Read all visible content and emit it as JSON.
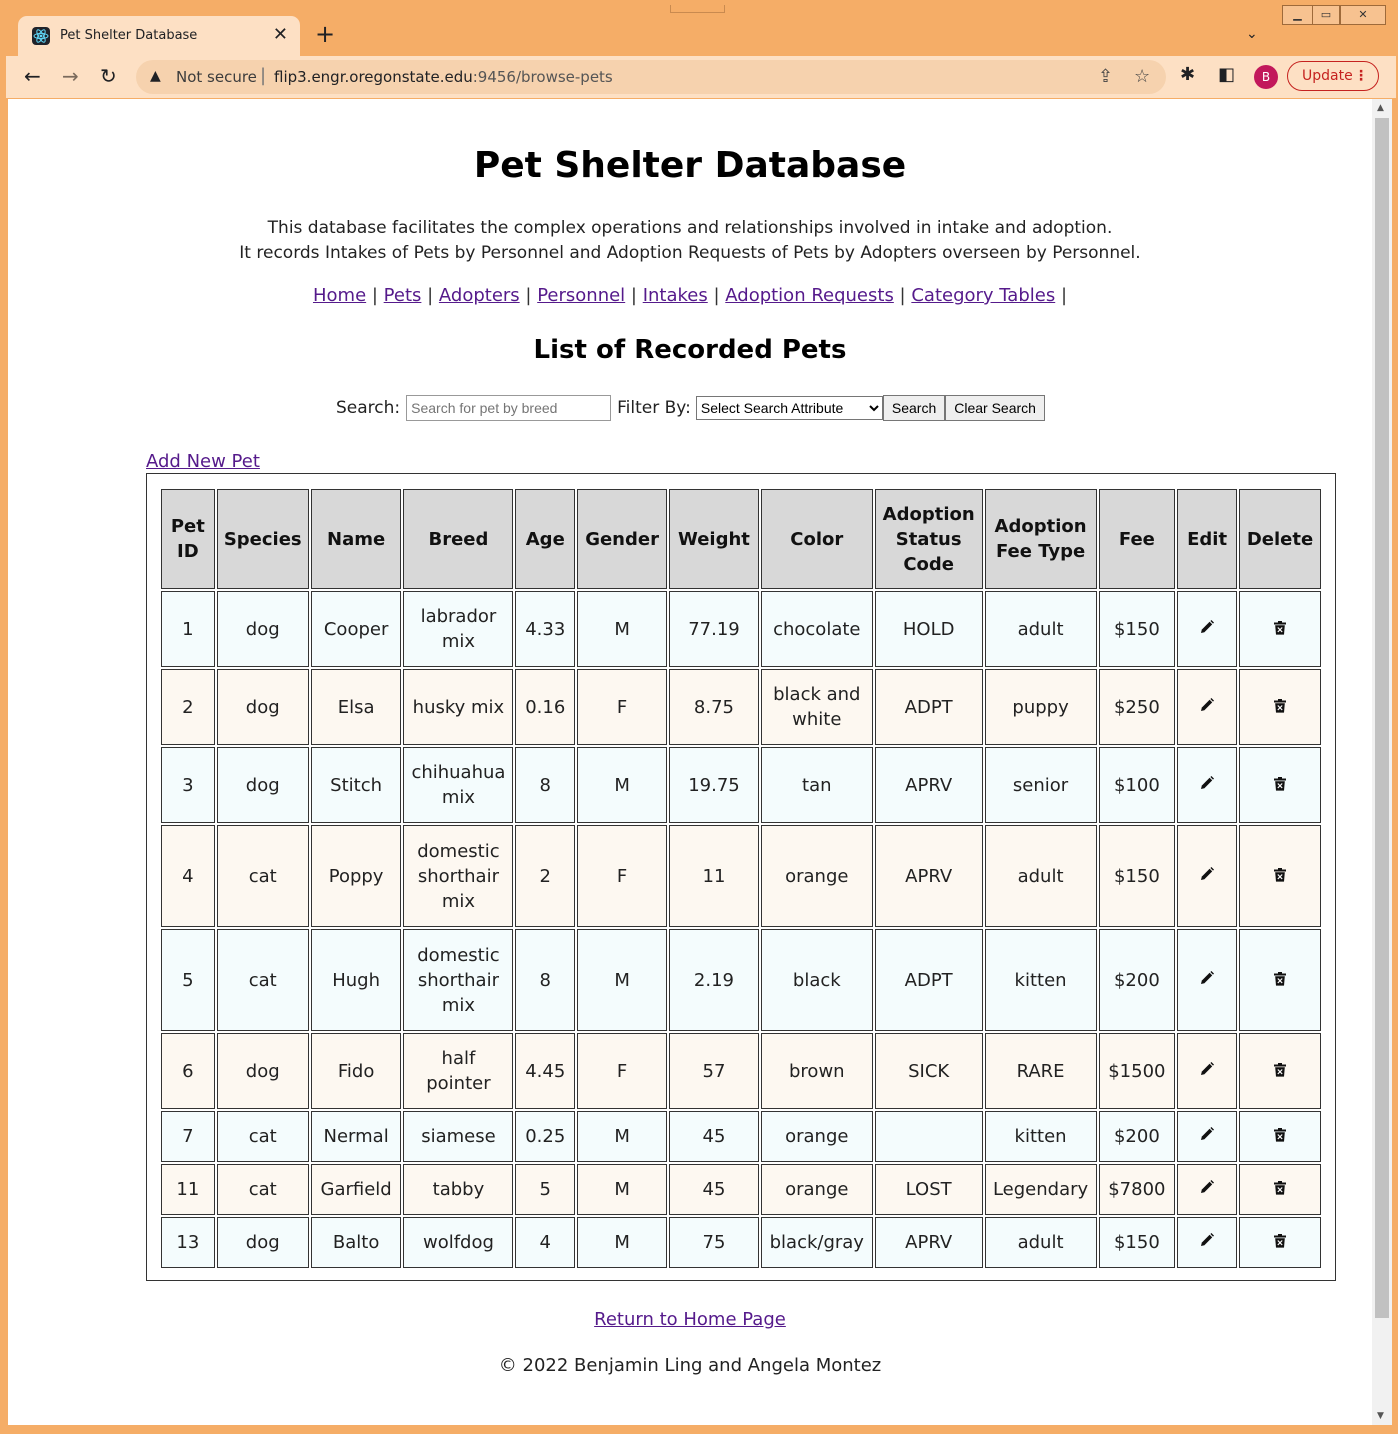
{
  "browser": {
    "tab_title": "Pet Shelter Database",
    "not_secure": "Not secure",
    "url_host": "flip3.engr.oregonstate.edu",
    "url_path": ":9456/browse-pets",
    "update_label": "Update",
    "avatar_letter": "B"
  },
  "page": {
    "title": "Pet Shelter Database",
    "desc_line1": "This database facilitates the complex operations and relationships involved in intake and adoption.",
    "desc_line2": "It records Intakes of Pets by Personnel and Adoption Requests of Pets by Adopters overseen by Personnel.",
    "nav": [
      {
        "label": "Home"
      },
      {
        "label": "Pets"
      },
      {
        "label": "Adopters"
      },
      {
        "label": "Personnel"
      },
      {
        "label": "Intakes"
      },
      {
        "label": "Adoption Requests"
      },
      {
        "label": "Category Tables"
      }
    ],
    "list_title": "List of Recorded Pets",
    "search_label": "Search:",
    "search_placeholder": "Search for pet by breed",
    "filter_label": "Filter By:",
    "filter_selected": "Select Search Attribute",
    "search_button": "Search",
    "clear_button": "Clear Search",
    "add_link": "Add New Pet",
    "return_link": "Return to Home Page",
    "copyright": "© 2022 Benjamin Ling and Angela Montez"
  },
  "table": {
    "headers": [
      "Pet ID",
      "Species",
      "Name",
      "Breed",
      "Age",
      "Gender",
      "Weight",
      "Color",
      "Adoption Status Code",
      "Adoption Fee Type",
      "Fee",
      "Edit",
      "Delete"
    ],
    "rows": [
      [
        "1",
        "dog",
        "Cooper",
        "labrador mix",
        "4.33",
        "M",
        "77.19",
        "chocolate",
        "HOLD",
        "adult",
        "$150"
      ],
      [
        "2",
        "dog",
        "Elsa",
        "husky mix",
        "0.16",
        "F",
        "8.75",
        "black and white",
        "ADPT",
        "puppy",
        "$250"
      ],
      [
        "3",
        "dog",
        "Stitch",
        "chihuahua mix",
        "8",
        "M",
        "19.75",
        "tan",
        "APRV",
        "senior",
        "$100"
      ],
      [
        "4",
        "cat",
        "Poppy",
        "domestic shorthair mix",
        "2",
        "F",
        "11",
        "orange",
        "APRV",
        "adult",
        "$150"
      ],
      [
        "5",
        "cat",
        "Hugh",
        "domestic shorthair mix",
        "8",
        "M",
        "2.19",
        "black",
        "ADPT",
        "kitten",
        "$200"
      ],
      [
        "6",
        "dog",
        "Fido",
        "half pointer",
        "4.45",
        "F",
        "57",
        "brown",
        "SICK",
        "RARE",
        "$1500"
      ],
      [
        "7",
        "cat",
        "Nermal",
        "siamese",
        "0.25",
        "M",
        "45",
        "orange",
        "",
        "kitten",
        "$200"
      ],
      [
        "11",
        "cat",
        "Garfield",
        "tabby",
        "5",
        "M",
        "45",
        "orange",
        "LOST",
        "Legendary",
        "$7800"
      ],
      [
        "13",
        "dog",
        "Balto",
        "wolfdog",
        "4",
        "M",
        "75",
        "black/gray",
        "APRV",
        "adult",
        "$150"
      ]
    ],
    "edit_icon": "pencil-icon",
    "delete_icon": "trash-icon"
  }
}
